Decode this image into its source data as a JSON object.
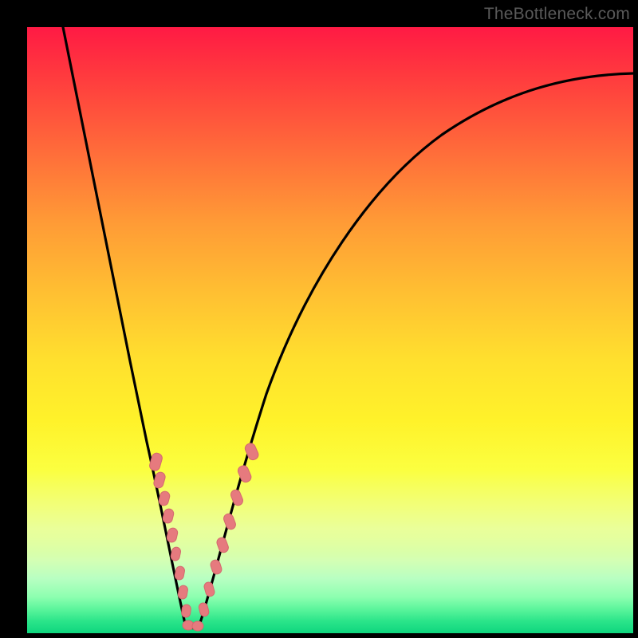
{
  "watermark": "TheBottleneck.com",
  "colors": {
    "background": "#000000",
    "curve": "#000000",
    "marker_fill": "#e67a7e",
    "marker_stroke": "#d46a6e"
  },
  "chart_data": {
    "type": "line",
    "title": "",
    "xlabel": "",
    "ylabel": "",
    "xlim": [
      0,
      100
    ],
    "ylim": [
      0,
      100
    ],
    "note": "Bottleneck-style chart: x ≈ relative component strength, y ≈ bottleneck %. Minimum (optimal balance) around x≈26. Values estimated from pixel positions; no axis ticks are shown in the source image.",
    "series": [
      {
        "name": "left-branch",
        "x": [
          6,
          8,
          10,
          12,
          14,
          16,
          18,
          20,
          22,
          24,
          25,
          26
        ],
        "y": [
          100,
          92,
          83,
          74,
          65,
          55,
          45,
          35,
          24,
          12,
          5,
          0
        ]
      },
      {
        "name": "right-branch",
        "x": [
          26,
          28,
          30,
          32,
          35,
          40,
          45,
          50,
          55,
          60,
          65,
          70,
          75,
          80,
          85,
          90,
          95,
          100
        ],
        "y": [
          0,
          6,
          14,
          22,
          32,
          45,
          55,
          62,
          68,
          72,
          76,
          79,
          82,
          84,
          86,
          87.5,
          89,
          90
        ]
      }
    ],
    "markers": {
      "name": "highlighted-points",
      "x": [
        21.0,
        21.6,
        22.3,
        23.0,
        23.8,
        24.5,
        25.3,
        26.0,
        27.0,
        28.0,
        29.0,
        30.0,
        30.8,
        31.6,
        32.4,
        33.2
      ],
      "y": [
        29,
        26,
        22,
        18,
        13,
        9,
        5,
        1,
        1,
        6,
        11,
        15,
        19,
        22,
        25,
        28
      ]
    }
  }
}
